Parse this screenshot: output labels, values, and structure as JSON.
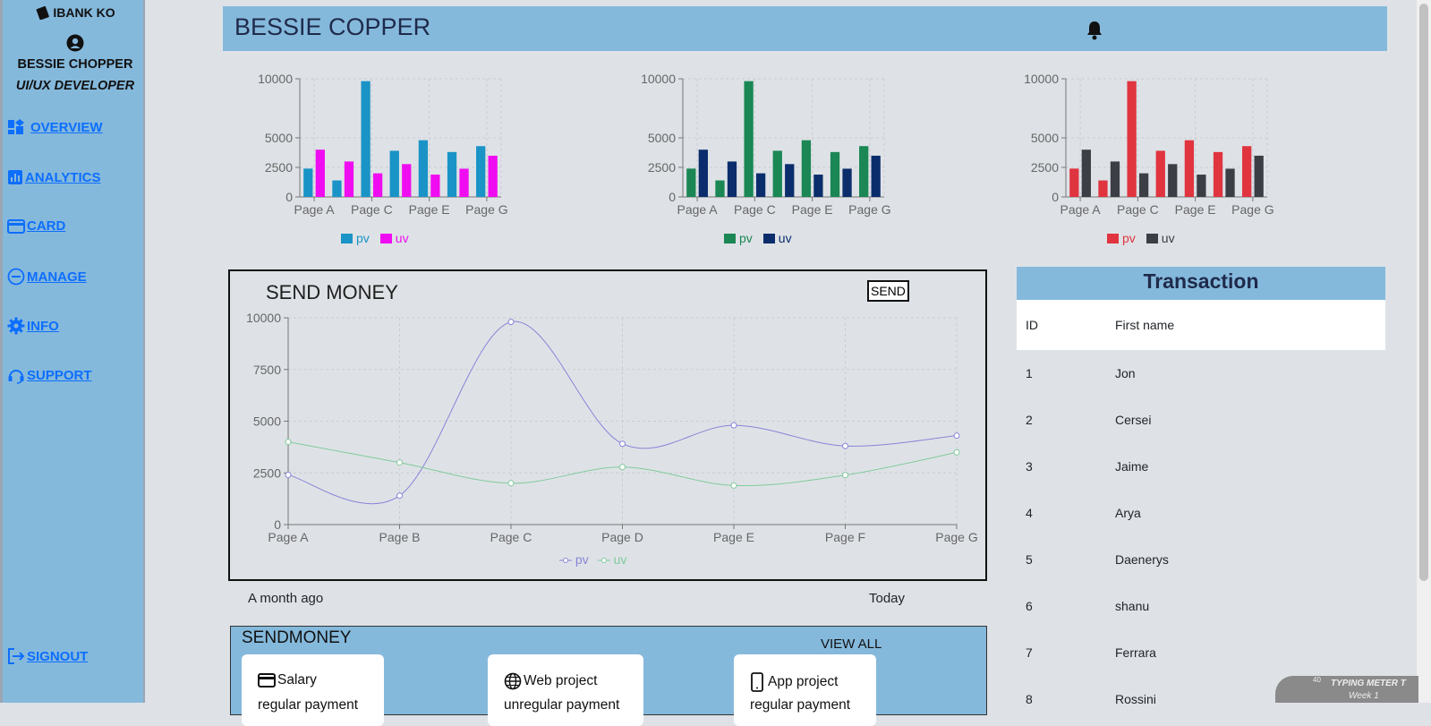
{
  "sidebar": {
    "brand": "IBANK KO",
    "user_name": "BESSIE CHOPPER",
    "user_role": "UI/UX DEVELOPER",
    "items": [
      {
        "label": "OVERVIEW",
        "icon": "dashboard-icon"
      },
      {
        "label": "ANALYTICS",
        "icon": "analytics-icon"
      },
      {
        "label": "CARD",
        "icon": "card-icon"
      },
      {
        "label": "MANAGE",
        "icon": "minus-circle-icon"
      },
      {
        "label": "INFO",
        "icon": "gear-icon"
      },
      {
        "label": "SUPPORT",
        "icon": "support-icon"
      }
    ],
    "signout": "SIGNOUT"
  },
  "header": {
    "title": "BESSIE COPPER",
    "icon": "bell-icon"
  },
  "chart_data": [
    {
      "type": "bar",
      "categories": [
        "Page A",
        "Page B",
        "Page C",
        "Page D",
        "Page E",
        "Page F",
        "Page G"
      ],
      "category_ticks": [
        "Page A",
        "Page C",
        "Page E",
        "Page G"
      ],
      "series": [
        {
          "name": "pv",
          "values": [
            2400,
            1398,
            9800,
            3908,
            4800,
            3800,
            4300
          ],
          "color": "#1a93c6"
        },
        {
          "name": "uv",
          "values": [
            4000,
            3000,
            2000,
            2780,
            1890,
            2390,
            3490
          ],
          "color": "#f00cf0"
        }
      ],
      "yticks": [
        0,
        2500,
        5000,
        10000
      ],
      "ylim": [
        0,
        10000
      ],
      "grid": true,
      "legend": "bottom"
    },
    {
      "type": "bar",
      "categories": [
        "Page A",
        "Page B",
        "Page C",
        "Page D",
        "Page E",
        "Page F",
        "Page G"
      ],
      "category_ticks": [
        "Page A",
        "Page C",
        "Page E",
        "Page G"
      ],
      "series": [
        {
          "name": "pv",
          "values": [
            2400,
            1398,
            9800,
            3908,
            4800,
            3800,
            4300
          ],
          "color": "#1a8754"
        },
        {
          "name": "uv",
          "values": [
            4000,
            3000,
            2000,
            2780,
            1890,
            2390,
            3490
          ],
          "color": "#0b2d6c"
        }
      ],
      "yticks": [
        0,
        2500,
        5000,
        10000
      ],
      "ylim": [
        0,
        10000
      ],
      "grid": true,
      "legend": "bottom"
    },
    {
      "type": "bar",
      "categories": [
        "Page A",
        "Page B",
        "Page C",
        "Page D",
        "Page E",
        "Page F",
        "Page G"
      ],
      "category_ticks": [
        "Page A",
        "Page C",
        "Page E",
        "Page G"
      ],
      "series": [
        {
          "name": "pv",
          "values": [
            2400,
            1398,
            9800,
            3908,
            4800,
            3800,
            4300
          ],
          "color": "#e0343f"
        },
        {
          "name": "uv",
          "values": [
            4000,
            3000,
            2000,
            2780,
            1890,
            2390,
            3490
          ],
          "color": "#3b3f45"
        }
      ],
      "yticks": [
        0,
        2500,
        5000,
        10000
      ],
      "ylim": [
        0,
        10000
      ],
      "grid": true,
      "legend": "bottom"
    },
    {
      "type": "line",
      "categories": [
        "Page A",
        "Page B",
        "Page C",
        "Page D",
        "Page E",
        "Page F",
        "Page G"
      ],
      "series": [
        {
          "name": "pv",
          "values": [
            2400,
            1398,
            9800,
            3908,
            4800,
            3800,
            4300
          ],
          "color": "#8884d8"
        },
        {
          "name": "uv",
          "values": [
            4000,
            3000,
            2000,
            2780,
            1890,
            2390,
            3490
          ],
          "color": "#82ca9d"
        }
      ],
      "yticks": [
        0,
        2500,
        5000,
        7500,
        10000
      ],
      "ylim": [
        0,
        10000
      ],
      "grid": true,
      "legend": "bottom"
    }
  ],
  "send_money": {
    "title": "SEND MONEY",
    "button": "SEND",
    "from_label": "A month ago",
    "to_label": "Today"
  },
  "sendmoney_panel": {
    "title": "SENDMONEY",
    "view_all": "VIEW ALL",
    "cards": [
      {
        "title": "Salary",
        "subtitle": "regular payment",
        "icon": "card-icon"
      },
      {
        "title": "Web project",
        "subtitle": "unregular payment",
        "icon": "globe-icon"
      },
      {
        "title": "App project",
        "subtitle": "regular payment",
        "icon": "phone-icon"
      }
    ]
  },
  "transactions": {
    "title": "Transaction",
    "columns": [
      "ID",
      "First name"
    ],
    "rows": [
      [
        "1",
        "Jon"
      ],
      [
        "2",
        "Cersei"
      ],
      [
        "3",
        "Jaime"
      ],
      [
        "4",
        "Arya"
      ],
      [
        "5",
        "Daenerys"
      ],
      [
        "6",
        "shanu"
      ],
      [
        "7",
        "Ferrara"
      ],
      [
        "8",
        "Rossini"
      ]
    ]
  },
  "widget": {
    "title": "TYPING METER T",
    "subtitle": "Week 1",
    "value": "40"
  }
}
